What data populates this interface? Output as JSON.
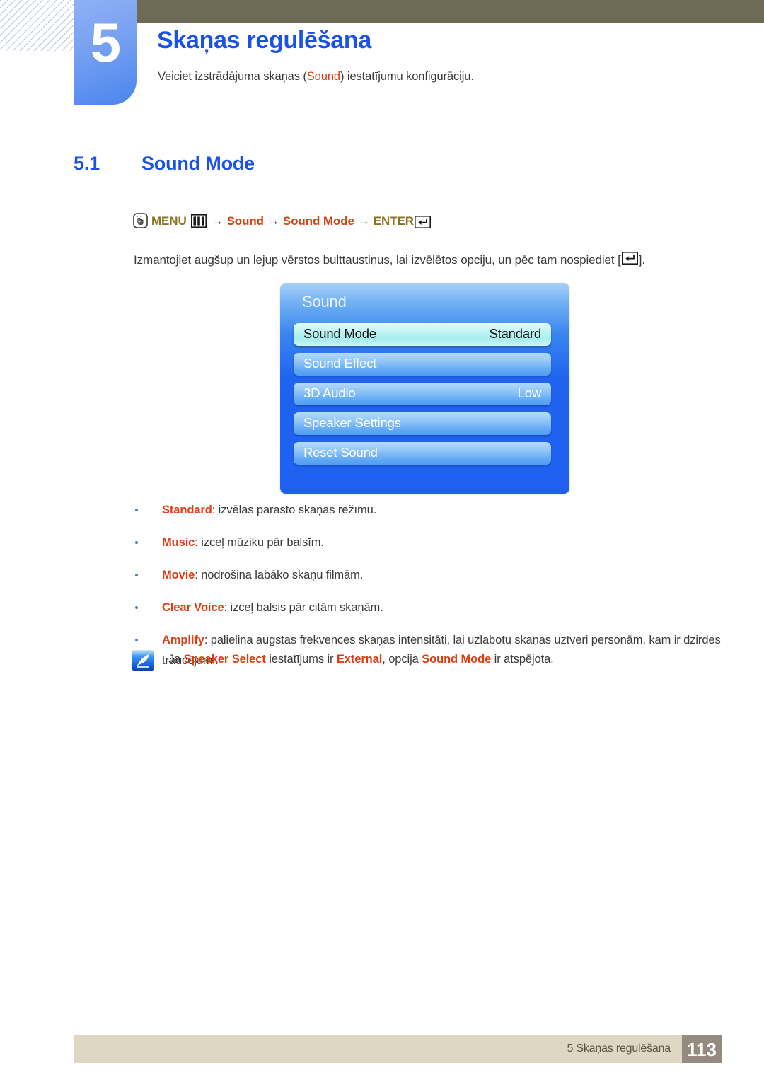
{
  "chapter": {
    "number": "5",
    "title": "Skaņas regulēšana",
    "description_prefix": "Veiciet izstrādājuma skaņas (",
    "description_term": "Sound",
    "description_suffix": ") iestatījumu konfigurāciju."
  },
  "section": {
    "number": "5.1",
    "title": "Sound Mode"
  },
  "path": {
    "hand_icon": "hand-press-icon",
    "menu_label": "MENU",
    "menu_icon": "menu-bars-icon",
    "arrow": "→",
    "step1": "Sound",
    "step2": "Sound Mode",
    "enter_label": "ENTER",
    "enter_icon": "enter-key-icon"
  },
  "instruction": {
    "before": "Izmantojiet augšup un lejup vērstos bulttaustiņus, lai izvēlētos opciju, un pēc tam nospiediet [",
    "after": "]."
  },
  "osd": {
    "title": "Sound",
    "rows": [
      {
        "label": "Sound Mode",
        "value": "Standard",
        "selected": true
      },
      {
        "label": "Sound Effect",
        "value": "",
        "selected": false
      },
      {
        "label": "3D Audio",
        "value": "Low",
        "selected": false
      },
      {
        "label": "Speaker Settings",
        "value": "",
        "selected": false
      },
      {
        "label": "Reset Sound",
        "value": "",
        "selected": false
      }
    ]
  },
  "bullets": [
    {
      "term": "Standard",
      "text": ": izvēlas parasto skaņas režīmu."
    },
    {
      "term": "Music",
      "text": ": izceļ mūziku pār balsīm."
    },
    {
      "term": "Movie",
      "text": ": nodrošina labāko skaņu filmām."
    },
    {
      "term": "Clear Voice",
      "text": ": izceļ balsis pār citām skaņām."
    },
    {
      "term": "Amplify",
      "text": ": palielina augstas frekvences skaņas intensitāti, lai uzlabotu skaņas uztveri personām, kam ir dzirdes traucējumi."
    }
  ],
  "note": {
    "icon": "note-quill-icon",
    "p1": "Ja ",
    "t1": "Speaker Select",
    "p2": " iestatījums ir ",
    "t2": "External",
    "p3": ", opcija ",
    "t3": "Sound Mode",
    "p4": " ir atspējota."
  },
  "footer": {
    "label": "5 Skaņas regulēšana",
    "page": "113"
  },
  "colors": {
    "heading_blue": "#1a52e8",
    "term_red": "#e03c12",
    "path_olive": "#8a7420",
    "olive_band": "#6e6a53",
    "footer_bg": "#ddd7c4",
    "page_box": "#948a7d",
    "osd_blue": "#1f63ef"
  }
}
